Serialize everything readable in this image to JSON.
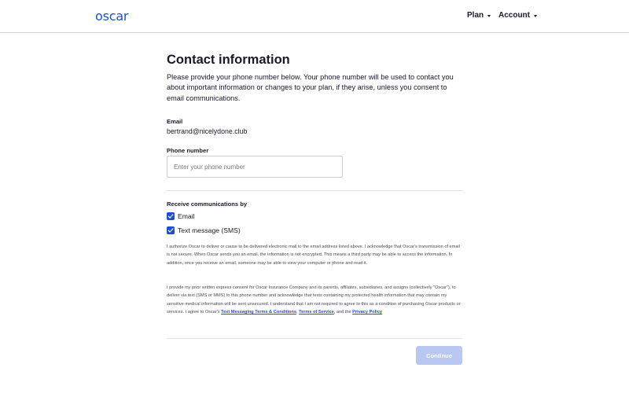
{
  "header": {
    "logo": "oscar",
    "nav": [
      {
        "label": "Plan",
        "icon": "chevron-down-icon"
      },
      {
        "label": "Account",
        "icon": "chevron-down-icon"
      }
    ]
  },
  "page": {
    "title": "Contact information",
    "intro": "Please provide your phone number below. Your phone number will be used to contact you about important information or changes to your plan, if they arise, unless you consent to email communications."
  },
  "email": {
    "label": "Email",
    "value": "bertrand@nicelydone.club"
  },
  "phone": {
    "label": "Phone number",
    "value": "",
    "placeholder": "Enter your phone number"
  },
  "communications": {
    "label": "Receive communications by",
    "options": [
      {
        "label": "Email",
        "checked": true
      },
      {
        "label": "Text message (SMS)",
        "checked": true
      }
    ]
  },
  "legal": {
    "paragraph1": "I authorize Oscar to deliver or cause to be delivered electronic mail to the email address listed above. I acknowledge that Oscar's transmission of email is not secure. When Oscar sends you an email, the information is not encrypted. This means a third party may be able to access the information. In addition, once you receive an email, someone may be able to view your computer or phone and read it.",
    "paragraph2_text": "I provide my prior written express consent for Oscar Insurance Company and its parents, affiliates, subsidiaries, and assigns (collectively \"Oscar\"), to deliver via text (SMS or MMS) to this phone number and acknowledge that texts containing my protected health information that may contain my sensitive medical information will be sent unsecured. I understand that I am not required to agree to this as a condition of purchasing Oscar products or services. I agree to Oscar's ",
    "link_sms_terms": "Text Messaging Terms & Conditions",
    "sep1": ", ",
    "link_terms": "Terms of Service",
    "sep2": ", and the ",
    "link_privacy": "Privacy Policy"
  },
  "actions": {
    "continue_label": "Continue"
  },
  "colors": {
    "brand": "#1c4fd7",
    "button_disabled": "#b8c8f3"
  }
}
